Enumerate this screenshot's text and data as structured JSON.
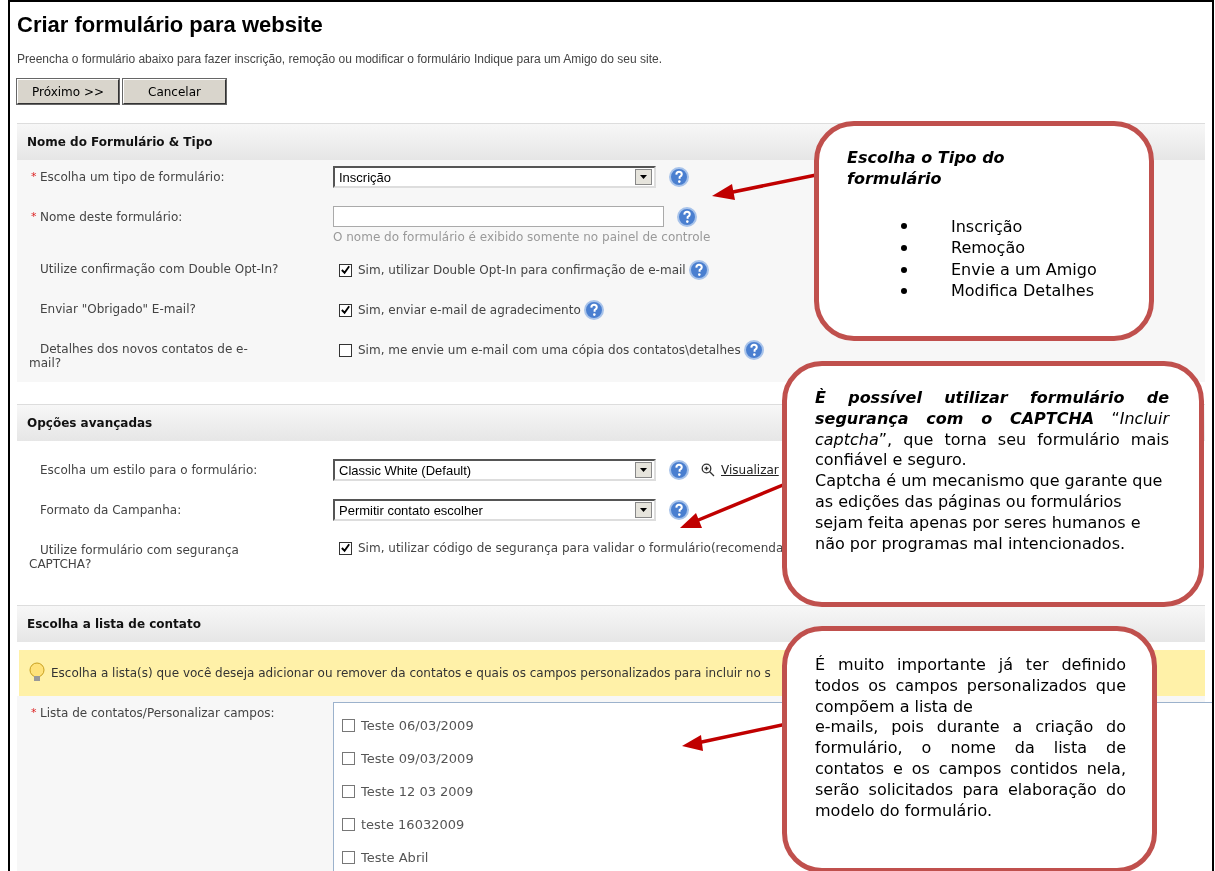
{
  "title": "Criar formulário para website",
  "description": "Preencha o formulário abaixo para fazer inscrição, remoção ou modificar o formulário Indique para um Amigo do seu site.",
  "buttons": [
    "Próximo >>",
    "Cancelar"
  ],
  "sections": [
    {
      "heading": "Nome do Formulário & Tipo",
      "rows": [
        {
          "kind": "select",
          "marker": "*",
          "label": "Escolha um tipo de formulário:",
          "value": "Inscrição",
          "help": true
        },
        {
          "kind": "text",
          "marker": "*",
          "label": "Nome deste formulário:",
          "help": true,
          "hint": "O nome do formulário é exibido somente no painel de controle"
        },
        {
          "kind": "checkbox",
          "label": "Utilize confirmação com Double Opt-In?",
          "checked": true,
          "text": "Sim, utilizar Double Opt-In para confirmação de e-mail",
          "help": true
        },
        {
          "kind": "checkbox",
          "label": "Enviar \"Obrigado\" E-mail?",
          "checked": true,
          "text": "Sim, enviar e-mail de agradecimento",
          "help": true
        },
        {
          "kind": "checkbox",
          "label": "Detalhes dos novos contatos de e-mail?",
          "checked": false,
          "text": "Sim, me envie um e-mail com uma cópia dos contatos\\detalhes",
          "help": true
        }
      ]
    },
    {
      "heading": "Opções avançadas",
      "rows": [
        {
          "kind": "select",
          "label": "Escolha um estilo para o formulário:",
          "value": "Classic White (Default)",
          "help": true,
          "link": "Visualizar"
        },
        {
          "kind": "select",
          "label": "Formato da Campanha:",
          "value": "Permitir contato escolher",
          "help": true
        },
        {
          "kind": "checkbox",
          "label": "Utilize formulário com segurança CAPTCHA?",
          "checked": true,
          "text": "Sim, utilizar código de segurança para validar o formulário(recomenda",
          "help": false
        }
      ]
    },
    {
      "heading": "Escolha a lista de contato",
      "tip": "Escolha a lista(s) que você deseja adicionar ou remover da contatos e quais os campos personalizados para incluir no s",
      "rows": [
        {
          "kind": "list",
          "marker": "*",
          "label": "Lista de contatos/Personalizar campos:",
          "help": false,
          "items": [
            {
              "label": "Teste 06/03/2009",
              "checked": false
            },
            {
              "label": "Teste 09/03/2009",
              "checked": false
            },
            {
              "label": "Teste 12 03 2009",
              "checked": false
            },
            {
              "label": "teste 16032009",
              "checked": false
            },
            {
              "label": "Teste Abril",
              "checked": false
            }
          ]
        }
      ]
    }
  ],
  "callouts": [
    {
      "kind": "list",
      "title": "Escolha o Tipo do formulário",
      "items": [
        "Inscrição",
        "Remoção",
        "Envie a um Amigo",
        "Modifica Detalhes"
      ]
    },
    {
      "kind": "paragraphs",
      "paragraphs": [
        "**È possível utilizar formulário de segurança com o CAPTCHA** “*Incluir captcha*”, que torna seu formulário mais confiável e seguro.",
        "Captcha é um mecanismo que garante que as edições das páginas ou formulários sejam feita apenas por seres humanos e não por programas mal intencionados."
      ]
    },
    {
      "kind": "paragraphs",
      "paragraphs": [
        "É muito importante já ter definido todos os campos personalizados que compõem a lista de\ne-mails, pois durante a criação do formulário, o nome da lista de contatos e os campos contidos nela, serão solicitados para elaboração do modelo do formulário."
      ]
    }
  ]
}
